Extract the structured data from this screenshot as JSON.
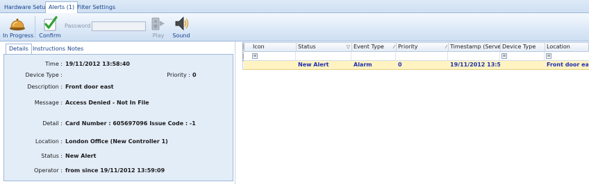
{
  "tabs": [
    {
      "label": "Hardware Setup"
    },
    {
      "label": "Alerts (1)"
    },
    {
      "label": "Filter Settings"
    }
  ],
  "ribbon": {
    "in_progress_label": "In Progress",
    "confirm_label": "Confirm",
    "password_label": "Password",
    "password_value": "",
    "play_label": "Play",
    "sound_label": "Sound"
  },
  "details": {
    "tabs": [
      {
        "label": "Details"
      },
      {
        "label": "Instructions"
      },
      {
        "label": "Notes"
      }
    ],
    "time_label": "Time :",
    "time_value": "19/11/2012 13:58:40",
    "device_type_label": "Device Type :",
    "device_type_value": "",
    "priority_label": "Priority :",
    "priority_value": "0",
    "description_label": "Description :",
    "description_value": "Front door east",
    "message_label": "Message :",
    "message_value": "Access Denied - Not In File",
    "detail_label": "Detail :",
    "detail_value": "Card Number : 605697096 Issue Code : -1",
    "location_label": "Location :",
    "location_value": "London Office (New Controller 1)",
    "status_label": "Status :",
    "status_value": "New Alert",
    "operator_label": "Operator :",
    "operator_value": "from  since 19/11/2012 13:59:09"
  },
  "grid": {
    "columns": [
      {
        "label": "Icon"
      },
      {
        "label": "Status"
      },
      {
        "label": "Event Type"
      },
      {
        "label": "Priority"
      },
      {
        "label": "Timestamp (Server)"
      },
      {
        "label": "Device Type"
      },
      {
        "label": "Location"
      }
    ],
    "rows": [
      {
        "icon": "",
        "status": "New Alert",
        "event_type": "Alarm",
        "priority": "0",
        "timestamp": "19/11/2012 13:5...",
        "device_type": "",
        "location": "Front door east"
      }
    ]
  },
  "colors": {
    "accent": "#15428b",
    "row_highlight": "#fff3c2",
    "row_text": "#1d2fb0",
    "confirm_green": "#2fa12f"
  }
}
